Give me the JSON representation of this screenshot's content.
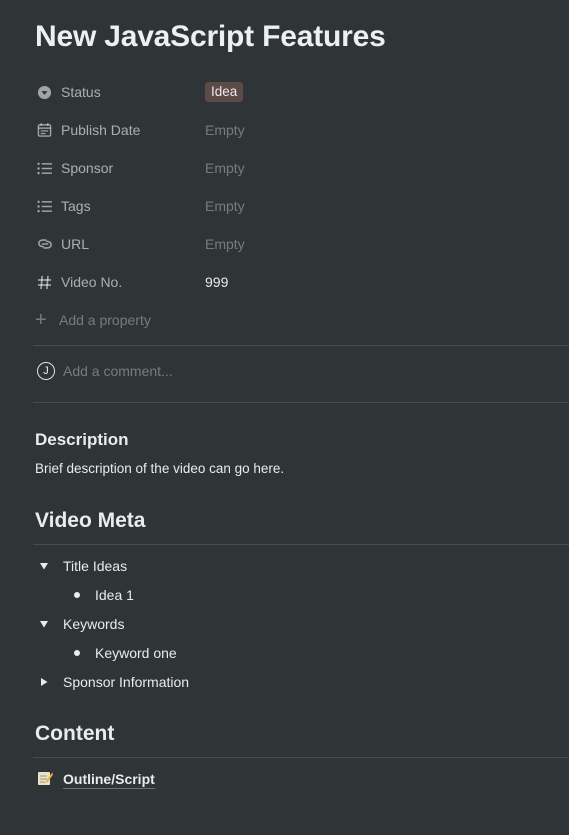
{
  "page": {
    "title": "New JavaScript Features"
  },
  "properties": [
    {
      "label": "Status",
      "value": "Idea",
      "icon": "status-icon",
      "type": "select"
    },
    {
      "label": "Publish Date",
      "value": "Empty",
      "icon": "calendar-icon",
      "type": "date"
    },
    {
      "label": "Sponsor",
      "value": "Empty",
      "icon": "list-icon",
      "type": "multi"
    },
    {
      "label": "Tags",
      "value": "Empty",
      "icon": "list-icon",
      "type": "multi"
    },
    {
      "label": "URL",
      "value": "Empty",
      "icon": "link-icon",
      "type": "url"
    },
    {
      "label": "Video No.",
      "value": "999",
      "icon": "hash-icon",
      "type": "number"
    }
  ],
  "add_property": {
    "label": "Add a property",
    "icon": "plus-icon"
  },
  "comment": {
    "avatar_initial": "J",
    "placeholder": "Add a comment..."
  },
  "description": {
    "heading": "Description",
    "text": "Brief description of the video can go here."
  },
  "video_meta": {
    "heading": "Video Meta",
    "toggles": [
      {
        "label": "Title Ideas",
        "expanded": true,
        "items": [
          "Idea 1"
        ]
      },
      {
        "label": "Keywords",
        "expanded": true,
        "items": [
          "Keyword one"
        ]
      },
      {
        "label": "Sponsor Information",
        "expanded": false,
        "items": []
      }
    ]
  },
  "content": {
    "heading": "Content",
    "link_label": "Outline/Script",
    "link_icon": "memo-icon"
  },
  "colors": {
    "background": "#2f3437",
    "status_tag_bg": "#5c4b46"
  }
}
